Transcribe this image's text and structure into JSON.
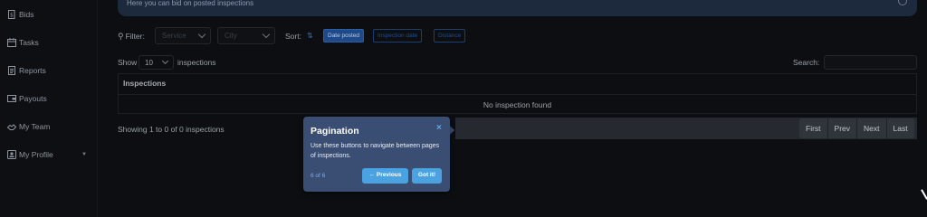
{
  "sidebar": {
    "items": [
      {
        "label": "Bids",
        "icon": "document-dollar-icon"
      },
      {
        "label": "Tasks",
        "icon": "calendar-icon"
      },
      {
        "label": "Reports",
        "icon": "report-icon"
      },
      {
        "label": "Payouts",
        "icon": "wallet-icon"
      },
      {
        "label": "My Team",
        "icon": "handshake-icon"
      },
      {
        "label": "My Profile",
        "icon": "id-card-icon"
      }
    ]
  },
  "banner": {
    "text": "Here you can bid on posted inspections"
  },
  "filters": {
    "label": "Filter:",
    "service_placeholder": "Service",
    "city_placeholder": "City",
    "sort_label": "Sort:",
    "sort_options": [
      "Date posted",
      "Inspection date",
      "Distance"
    ]
  },
  "table_controls": {
    "show_label": "Show",
    "page_size": "10",
    "show_suffix": "inspections",
    "search_label": "Search:"
  },
  "table": {
    "column_header": "Inspections",
    "empty_message": "No inspection found"
  },
  "footer": {
    "showing_text": "Showing 1 to 0 of 0 inspections",
    "pager": [
      "First",
      "Prev",
      "Next",
      "Last"
    ]
  },
  "tour": {
    "title": "Pagination",
    "close": "×",
    "body": "Use these buttons to navigate between pages of inspections.",
    "step": "6 of 6",
    "prev_label": "← Previous",
    "done_label": "Got it!"
  },
  "colors": {
    "accent": "#1f4a8a",
    "tour_bg": "#3a4d73",
    "tour_button": "#4aa3e0"
  }
}
